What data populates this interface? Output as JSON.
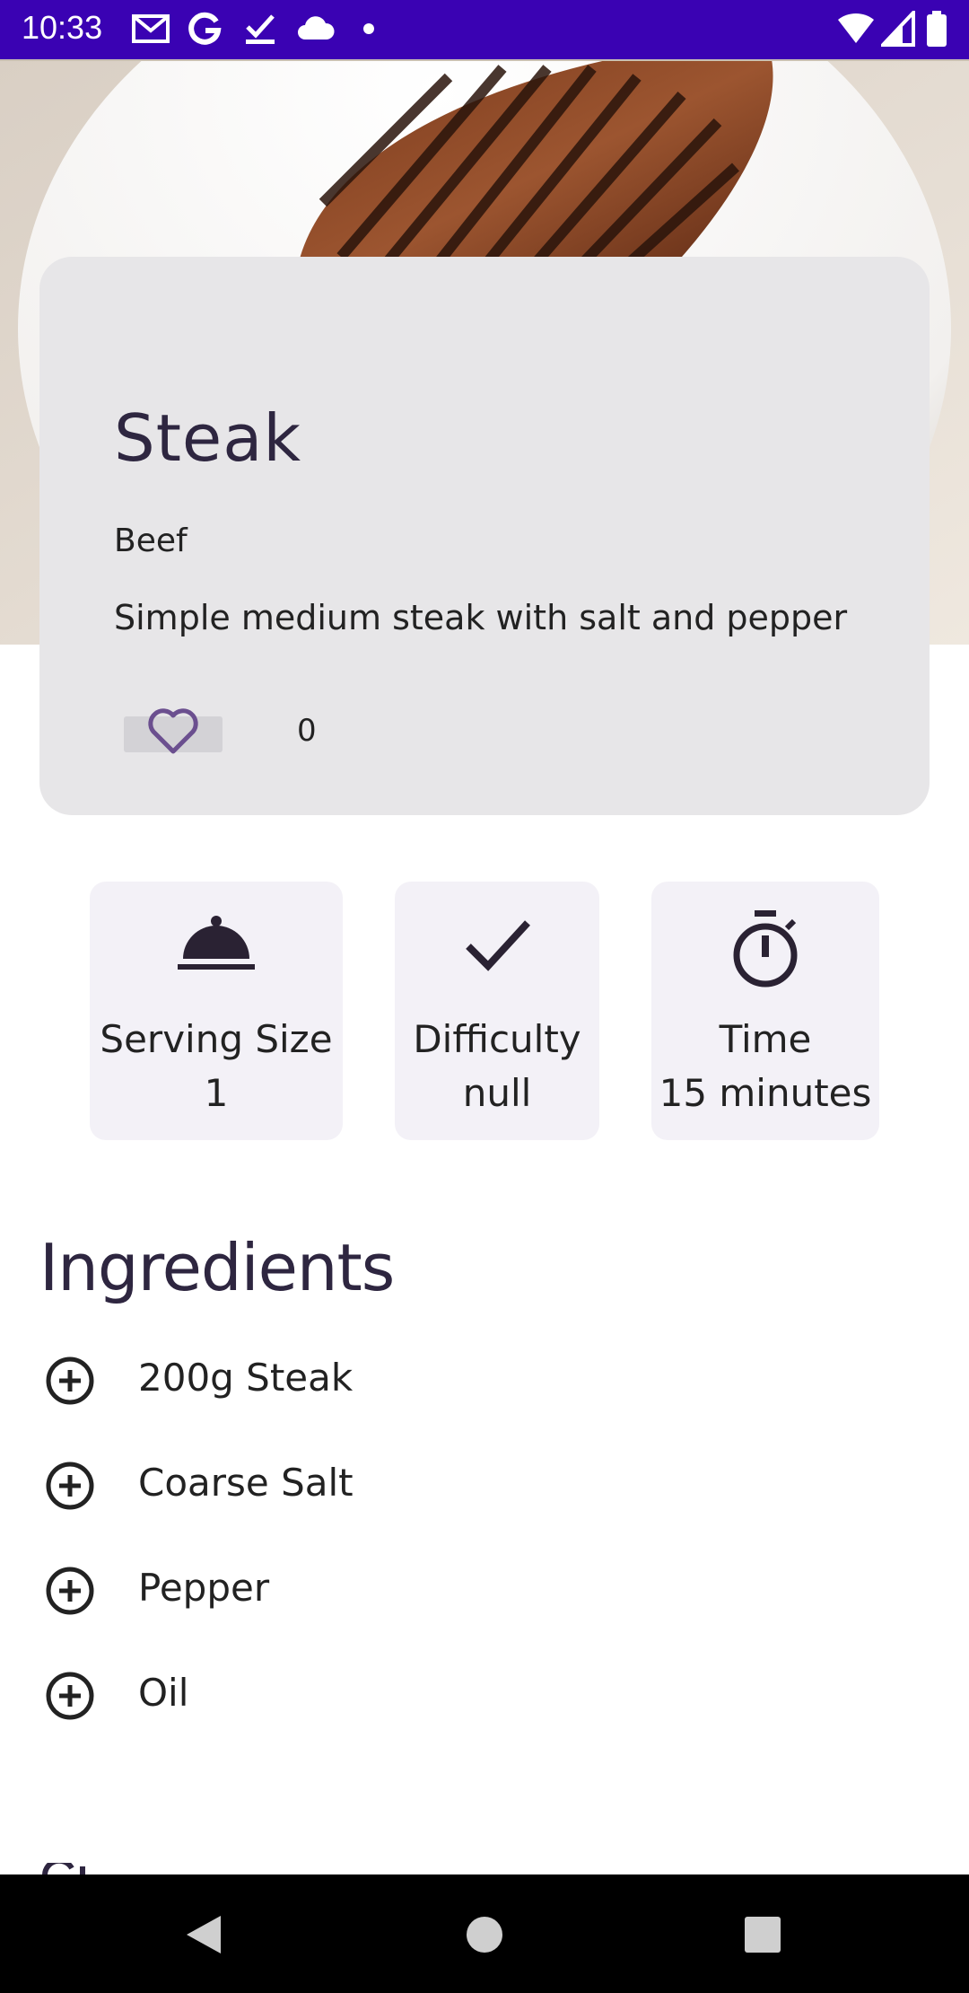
{
  "status_bar": {
    "time": "10:33",
    "left_icons": [
      "gmail-icon",
      "google-icon",
      "task-check-icon",
      "cloud-icon",
      "dot-icon"
    ],
    "right_icons": [
      "wifi-icon",
      "signal-icon",
      "battery-icon"
    ],
    "background": "#3a02b3"
  },
  "hero": {
    "image": "grilled-steak-photo"
  },
  "recipe": {
    "title": "Steak",
    "category": "Beef",
    "description": "Simple medium steak with salt and pepper",
    "like_count": "0"
  },
  "info_tiles": [
    {
      "icon": "serving-dish-icon",
      "label": "Serving Size",
      "value": "1"
    },
    {
      "icon": "check-icon",
      "label": "Difficulty",
      "value": "null"
    },
    {
      "icon": "timer-icon",
      "label": "Time",
      "value": "15 minutes"
    }
  ],
  "ingredients": {
    "heading": "Ingredients",
    "items": [
      {
        "label": "200g Steak",
        "icon": "add-circle-icon"
      },
      {
        "label": "Coarse Salt",
        "icon": "add-circle-icon"
      },
      {
        "label": "Pepper",
        "icon": "add-circle-icon"
      },
      {
        "label": "Oil",
        "icon": "add-circle-icon"
      }
    ]
  },
  "nav_bar": {
    "buttons": [
      "back-icon",
      "home-icon",
      "recents-icon"
    ]
  },
  "colors": {
    "accent": "#3a02b3",
    "heart": "#6b4f8f",
    "title": "#2e2640",
    "card": "#e7e6e8",
    "tile": "#f3f1f7"
  }
}
